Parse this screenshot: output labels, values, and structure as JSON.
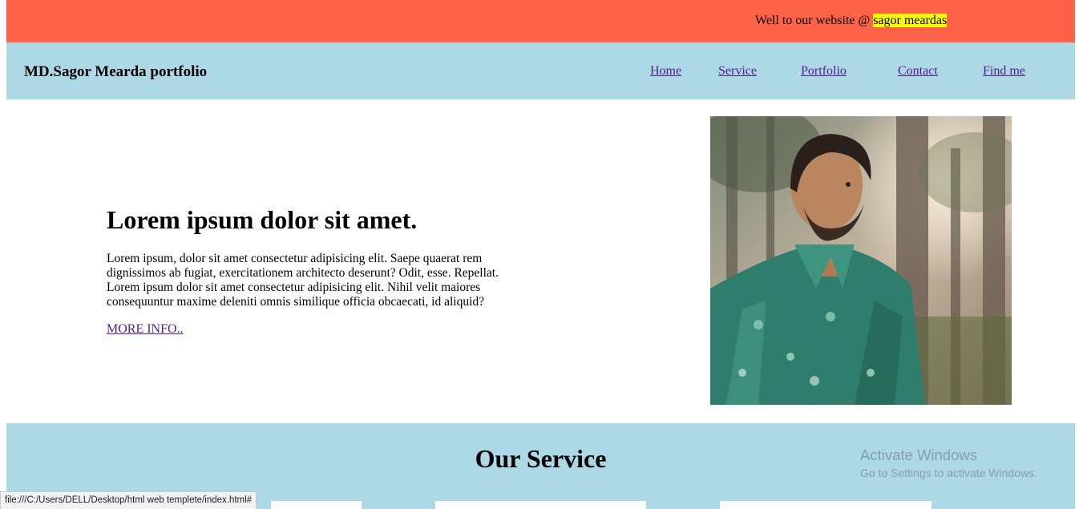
{
  "topbar": {
    "welcome_text": "Well to our website @ ",
    "highlight_text": "sagor meardas",
    "background_color": "#ff6347",
    "highlight_color": "#ffff00"
  },
  "navbar": {
    "brand": "MD.Sagor Mearda portfolio",
    "background_color": "#add8e6",
    "links": [
      {
        "label": "Home"
      },
      {
        "label": "Service"
      },
      {
        "label": "Portfolio"
      },
      {
        "label": "Contact"
      },
      {
        "label": "Find me"
      }
    ]
  },
  "hero": {
    "title": "Lorem ipsum dolor sit amet.",
    "paragraph": "Lorem ipsum, dolor sit amet consectetur adipisicing elit. Saepe quaerat rem dignissimos ab fugiat, exercitationem architecto deserunt? Odit, esse. Repellat. Lorem ipsum dolor sit amet consectetur adipisicing elit. Nihil velit maiores consequuntur maxime deleniti omnis similique officia obcaecati, id aliquid?",
    "more_link": "MORE INFO..",
    "photo_icon": "portrait-photo"
  },
  "service": {
    "title": "Our Service",
    "background_color": "#add8e6"
  },
  "watermark": {
    "line1": "Activate Windows",
    "line2": "Go to Settings to activate Windows."
  },
  "statusbar": {
    "url": "file:///C:/Users/DELL/Desktop/html web templete/index.html#"
  }
}
